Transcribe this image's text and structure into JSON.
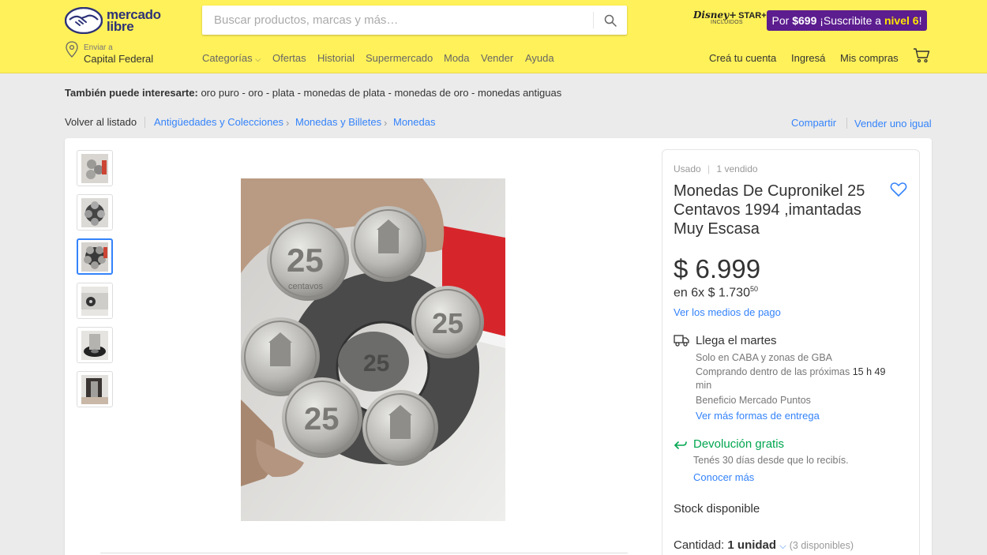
{
  "header": {
    "logo_line1": "mercado",
    "logo_line2": "libre",
    "search_placeholder": "Buscar productos, marcas y más…",
    "disney_label": "Disney+",
    "star_label": "STAR+",
    "disney_sub": "INCLUIDOS",
    "promo": {
      "pre": "Por ",
      "price": "$699",
      "mid": " ¡Suscribite a ",
      "level": "nivel 6",
      "end": "!"
    },
    "location_label": "Enviar a",
    "location_value": "Capital Federal",
    "nav": [
      "Categorías",
      "Ofertas",
      "Historial",
      "Supermercado",
      "Moda",
      "Vender",
      "Ayuda"
    ],
    "account": {
      "create": "Creá tu cuenta",
      "login": "Ingresá",
      "purchases": "Mis compras"
    }
  },
  "interest": {
    "label": "También puede interesarte:",
    "items": [
      "oro puro",
      "oro",
      "plata",
      "monedas de plata",
      "monedas de oro",
      "monedas antiguas"
    ]
  },
  "breadcrumb": {
    "back": "Volver al listado",
    "items": [
      "Antigüedades y Colecciones",
      "Monedas y Billetes",
      "Monedas"
    ],
    "share": "Compartir",
    "sell_same": "Vender uno igual"
  },
  "gallery": {
    "thumb_count": 6,
    "selected_index": 2
  },
  "product": {
    "condition": "Usado",
    "sold": "1 vendido",
    "title": "Monedas De Cupronikel 25 Centavos 1994 ,imantadas Muy Escasa",
    "price": "$ 6.999",
    "installments_prefix": "en 6x $ 1.730",
    "installments_cents": "50",
    "payment_link": "Ver los medios de pago",
    "shipping": {
      "title": "Llega el martes",
      "line1": "Solo en CABA y zonas de GBA",
      "line2_pre": "Comprando dentro de las próximas",
      "line2_time": "15 h 49",
      "line3": "min",
      "line4": "Beneficio Mercado Puntos",
      "link": "Ver más formas de entrega"
    },
    "returns": {
      "title": "Devolución gratis",
      "sub": "Tenés 30 días desde que lo recibís.",
      "link": "Conocer más"
    },
    "stock": "Stock disponible",
    "quantity_label": "Cantidad:",
    "quantity_value": "1 unidad",
    "quantity_available": "(3 disponibles)"
  },
  "colors": {
    "header_yellow": "#fff159",
    "link_blue": "#3483fa",
    "green": "#00a650",
    "promo_purple": "#5c1d8f"
  }
}
